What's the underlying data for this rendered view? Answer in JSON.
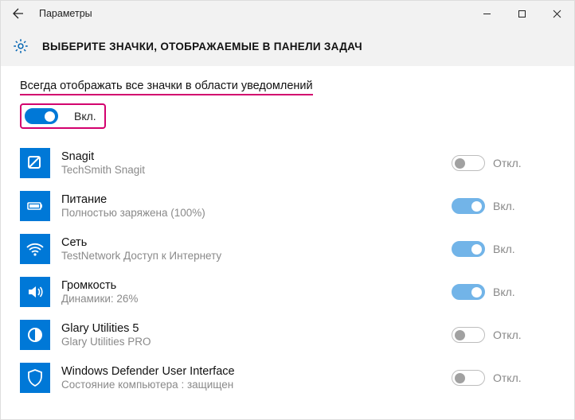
{
  "window": {
    "title": "Параметры"
  },
  "page": {
    "heading": "ВЫБЕРИТЕ ЗНАЧКИ, ОТОБРАЖАЕМЫЕ В ПАНЕЛИ ЗАДАЧ"
  },
  "master": {
    "label": "Всегда отображать все значки в области уведомлений",
    "state": "Вкл.",
    "on": true
  },
  "state_labels": {
    "on": "Вкл.",
    "off": "Откл."
  },
  "items": [
    {
      "name": "Snagit",
      "sub": "TechSmith Snagit",
      "on": false,
      "disabled": true,
      "icon": "snagit"
    },
    {
      "name": "Питание",
      "sub": "Полностью заряжена (100%)",
      "on": true,
      "disabled": true,
      "icon": "battery"
    },
    {
      "name": "Сеть",
      "sub": "TestNetwork Доступ к Интернету",
      "on": true,
      "disabled": true,
      "icon": "wifi"
    },
    {
      "name": "Громкость",
      "sub": "Динамики: 26%",
      "on": true,
      "disabled": true,
      "icon": "volume"
    },
    {
      "name": "Glary Utilities 5",
      "sub": "Glary Utilities PRO",
      "on": false,
      "disabled": true,
      "icon": "glary"
    },
    {
      "name": "Windows Defender User Interface",
      "sub": "Состояние компьютера : защищен",
      "on": false,
      "disabled": true,
      "icon": "defender"
    }
  ]
}
